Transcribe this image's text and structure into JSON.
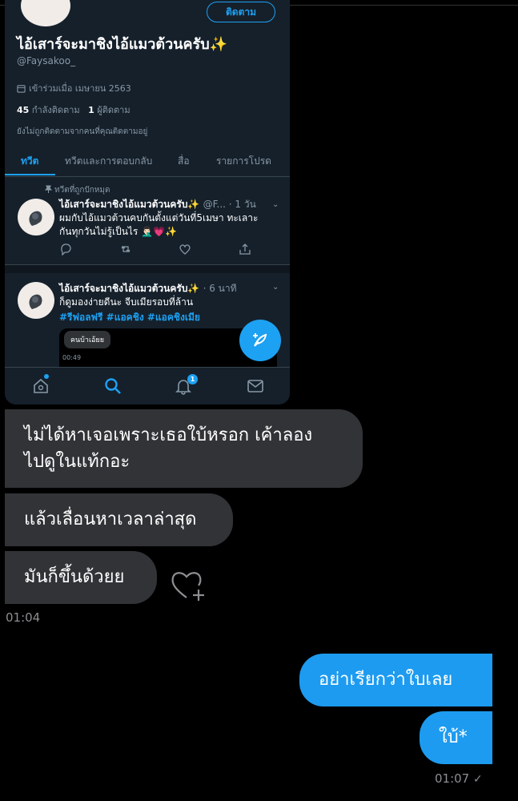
{
  "profile": {
    "follow_label": "ติดตาม",
    "name": "ไอ้เสาร์จะมาชิงไอ้แมวต้วนครับ✨",
    "handle": "@Faysakoo_",
    "joined": "เข้าร่วมเมื่อ เมษายน 2563",
    "following_count": "45",
    "following_label": "กำลังติดตาม",
    "followers_count": "1",
    "followers_label": "ผู้ติดตาม",
    "note": "ยังไม่ถูกติดตามจากคนที่คุณติดตามอยู่"
  },
  "tabs": [
    "ทวีต",
    "ทวีตและการตอบกลับ",
    "สื่อ",
    "รายการโปรด"
  ],
  "pinned_label": "ทวีตที่ถูกปักหมุด",
  "tweets": [
    {
      "name": "ไอ้เสาร์จะมาชิงไอ้แมวต้วนครับ✨",
      "meta": "@F... · 1 วัน",
      "line1": "ผมกับไอ้แมวต้วนคบกันตั้งแต่วันที่5เมษา ทะเลาะ",
      "line2": "กันทุกวันไม่รู้เป็นไร 🤦🏻‍♂️💗✨"
    },
    {
      "name": "ไอ้เสาร์จะมาชิงไอ้แมวต้วนครับ✨",
      "meta": "· 6 นาที",
      "line1": "ก็ดูมองง่ายดีนะ จีบเมียรอบที่ล้าน",
      "hashtags": "#รีฟอลฟรี #แอคชิง #แอคชิงเมีย",
      "video_chip": "คนบ้าเอ้ยย",
      "video_time": "00:49"
    }
  ],
  "nav_badge": "1",
  "chat": {
    "incoming": [
      {
        "line1": "ไม่ได้หาเจอเพราะเธอใบ้หรอก เค้าลอง",
        "line2": "ไปดูในแท้กอะ"
      },
      {
        "line1": "แล้วเลื่อนหาเวลาล่าสุด"
      },
      {
        "line1": "มันก็ขึ้นด้วยย"
      }
    ],
    "incoming_time": "01:04",
    "outgoing": [
      {
        "line1": "อย่าเรียกว่าใบเลย"
      },
      {
        "line1": "ใบ้*"
      }
    ],
    "outgoing_time": "01:07"
  },
  "colors": {
    "accent": "#1da1f2",
    "incoming_bubble": "#313336",
    "outgoing_bubble": "#1d9bf0",
    "twitter_bg": "#15202b"
  }
}
